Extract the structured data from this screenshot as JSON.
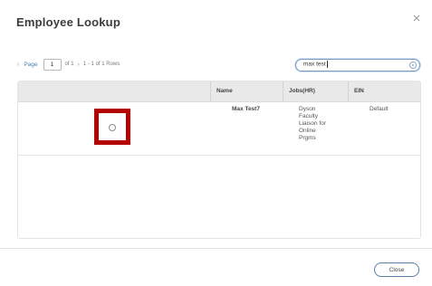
{
  "dialog": {
    "title": "Employee Lookup",
    "close_icon": "×"
  },
  "pager": {
    "prev_icon": "‹",
    "page_label": "Page",
    "page_value": "1",
    "of_text": "of 1",
    "next_icon": "›",
    "range_text": "1 - 1 of 1 Rows"
  },
  "search": {
    "value": "max test",
    "clear_icon": "circle-clear-icon"
  },
  "table": {
    "columns": [
      "Name",
      "Jobs(HR)",
      "EIN"
    ],
    "rows": [
      {
        "name": "Max Test7",
        "jobs": [
          "Dyson",
          "Faculty",
          "Liaison for",
          "Online",
          "Prgms"
        ],
        "ein": "Default"
      }
    ]
  },
  "footer": {
    "close_label": "Close"
  },
  "colors": {
    "highlight": "#b30000",
    "accent": "#5a7fa8"
  }
}
